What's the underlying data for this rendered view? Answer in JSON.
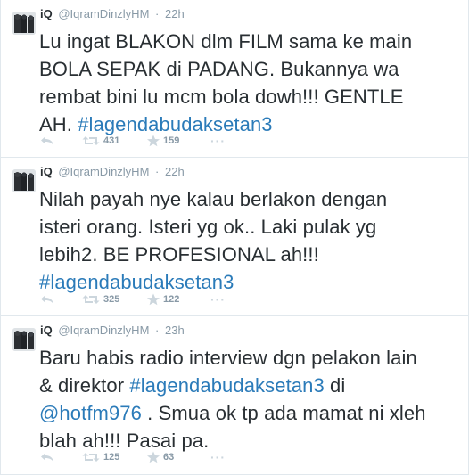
{
  "tweets": [
    {
      "fullname": "iQ",
      "username": "@IqramDinzlyHM",
      "separator": "·",
      "time": "22h",
      "text_lines": [
        "Lu ingat BLAKON dlm FILM sama ke main",
        "BOLA SEPAK di PADANG. Bukannya wa",
        "rembat bini lu mcm bola dowh!!! GENTLE",
        "AH. "
      ],
      "hashtag": "#lagendabudaksetan3",
      "retweets": "431",
      "favorites": "159",
      "more": "···"
    },
    {
      "fullname": "iQ",
      "username": "@IqramDinzlyHM",
      "separator": "·",
      "time": "22h",
      "text_lines": [
        "Nilah payah nye kalau berlakon dengan",
        "isteri orang. Isteri yg ok.. Laki pulak yg",
        "lebih2. BE PROFESIONAL ah!!!"
      ],
      "hashtag": "#lagendabudaksetan3",
      "retweets": "325",
      "favorites": "122",
      "more": "···"
    },
    {
      "fullname": "iQ",
      "username": "@IqramDinzlyHM",
      "separator": "·",
      "time": "23h",
      "line1": "Baru habis radio interview dgn pelakon lain",
      "line2_pre": "& direktor ",
      "hashtag": "#lagendabudaksetan3",
      "line2_post": " di",
      "mention": "@hotfm976",
      "line3_post": " . Smua ok tp ada mamat ni xleh",
      "line4": "blah ah!!! Pasai pa.",
      "retweets": "125",
      "favorites": "63",
      "more": "···"
    }
  ],
  "icons": {
    "reply": "reply-icon",
    "retweet": "retweet-icon",
    "favorite": "star-icon",
    "more": "more-icon"
  },
  "colors": {
    "link": "#2b7bb9",
    "meta": "#8899a6",
    "text": "#292f33",
    "icon": "#ccd6dd"
  }
}
